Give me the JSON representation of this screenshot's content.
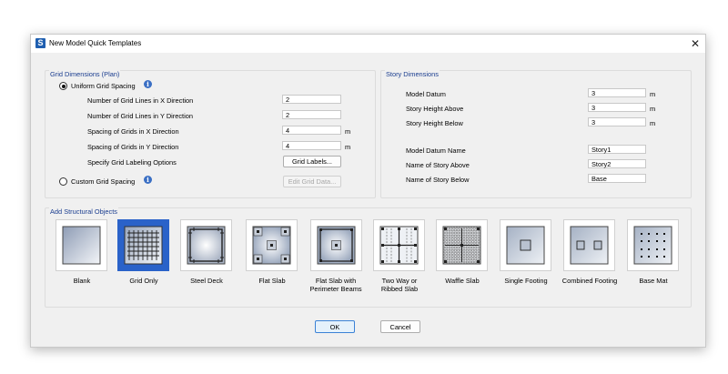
{
  "window": {
    "title": "New Model Quick Templates",
    "app_icon_letter": "S",
    "close_glyph": "✕"
  },
  "grid_dimensions": {
    "title": "Grid Dimensions (Plan)",
    "uniform_label": "Uniform Grid Spacing",
    "uniform_selected": true,
    "rows": [
      {
        "label": "Number of Grid Lines in X Direction",
        "value": "2",
        "unit": ""
      },
      {
        "label": "Number of Grid Lines in Y Direction",
        "value": "2",
        "unit": ""
      },
      {
        "label": "Spacing of Grids in X Direction",
        "value": "4",
        "unit": "m"
      },
      {
        "label": "Spacing of Grids in Y Direction",
        "value": "4",
        "unit": "m"
      }
    ],
    "labeling_label": "Specify Grid Labeling Options",
    "grid_labels_button": "Grid Labels...",
    "custom_label": "Custom Grid Spacing",
    "edit_grid_button": "Edit Grid Data..."
  },
  "story_dimensions": {
    "title": "Story Dimensions",
    "rows": [
      {
        "label": "Model Datum",
        "value": "3",
        "unit": "m"
      },
      {
        "label": "Story Height Above",
        "value": "3",
        "unit": "m"
      },
      {
        "label": "Story Height Below",
        "value": "3",
        "unit": "m"
      }
    ],
    "names": [
      {
        "label": "Model Datum Name",
        "value": "Story1"
      },
      {
        "label": "Name of Story Above",
        "value": "Story2"
      },
      {
        "label": "Name of Story Below",
        "value": "Base"
      }
    ]
  },
  "structural_objects": {
    "title": "Add Structural Objects",
    "selected": "Grid Only",
    "items": [
      {
        "label": "Blank"
      },
      {
        "label": "Grid Only"
      },
      {
        "label": "Steel Deck"
      },
      {
        "label": "Flat Slab"
      },
      {
        "label": "Flat Slab with Perimeter Beams"
      },
      {
        "label": "Two Way or Ribbed Slab"
      },
      {
        "label": "Waffle Slab"
      },
      {
        "label": "Single Footing"
      },
      {
        "label": "Combined Footing"
      },
      {
        "label": "Base Mat"
      }
    ]
  },
  "footer": {
    "ok_label": "OK",
    "cancel_label": "Cancel"
  }
}
